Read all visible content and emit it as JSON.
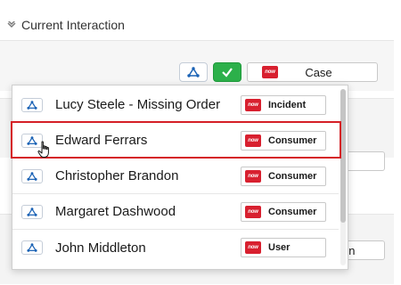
{
  "section": {
    "title": "Current Interaction",
    "toggle_icon": "chevron-down-icon"
  },
  "toolbar": {
    "type_icon": "graph-node-icon",
    "check_icon": "checkmark-icon",
    "case_label": "Case",
    "case_icon": "servicenow-now-icon"
  },
  "background": {
    "peek_box_text": "on"
  },
  "dropdown": {
    "items": [
      {
        "name": "Lucy Steele - Missing Order",
        "tag": "Incident",
        "icon": "graph-node-icon",
        "tag_icon": "servicenow-now-icon"
      },
      {
        "name": "Edward Ferrars",
        "tag": "Consumer",
        "icon": "graph-node-icon",
        "tag_icon": "servicenow-now-icon",
        "highlighted": true
      },
      {
        "name": "Christopher Brandon",
        "tag": "Consumer",
        "icon": "graph-node-icon",
        "tag_icon": "servicenow-now-icon"
      },
      {
        "name": "Margaret Dashwood",
        "tag": "Consumer",
        "icon": "graph-node-icon",
        "tag_icon": "servicenow-now-icon"
      },
      {
        "name": "John Middleton",
        "tag": "User",
        "icon": "graph-node-icon",
        "tag_icon": "servicenow-now-icon"
      }
    ]
  },
  "now_tag_text": "now",
  "colors": {
    "accent_blue": "#1a62b5",
    "check_green": "#2cb04a",
    "highlight_red": "#d51f26",
    "now_red": "#d8202f"
  }
}
